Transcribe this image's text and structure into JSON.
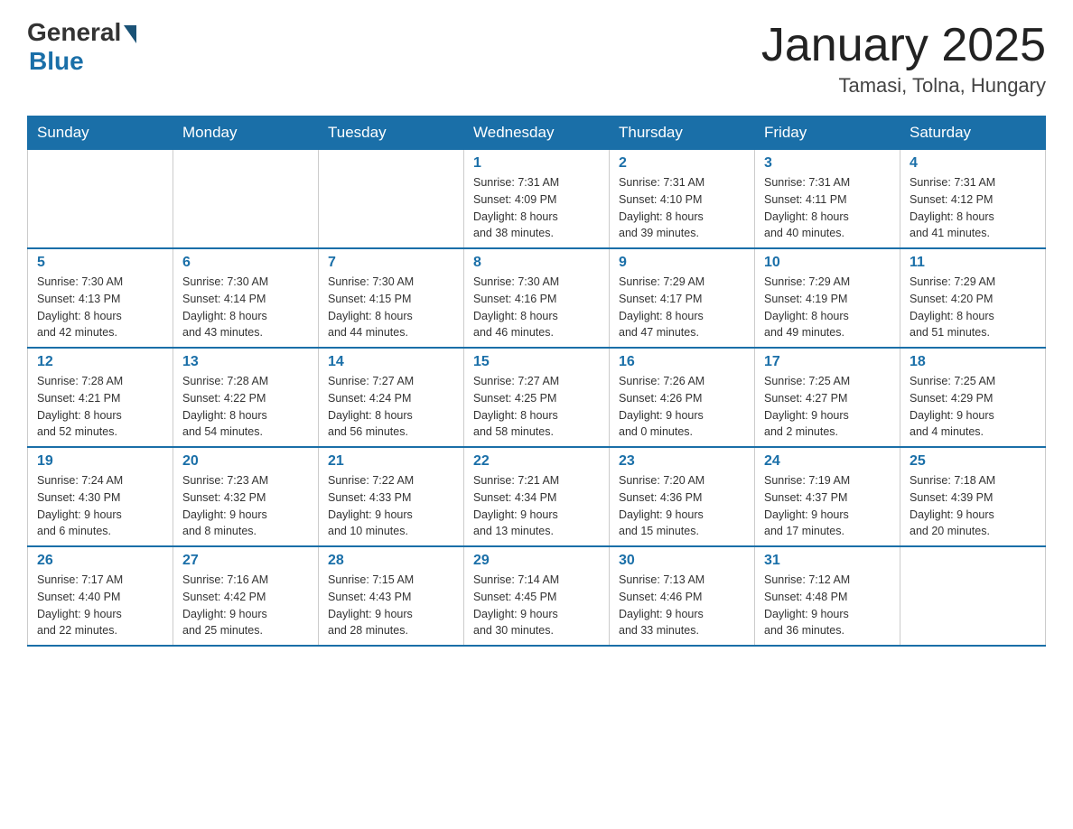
{
  "header": {
    "logo_general": "General",
    "logo_blue": "Blue",
    "month_title": "January 2025",
    "location": "Tamasi, Tolna, Hungary"
  },
  "days_of_week": [
    "Sunday",
    "Monday",
    "Tuesday",
    "Wednesday",
    "Thursday",
    "Friday",
    "Saturday"
  ],
  "weeks": [
    [
      {
        "day": "",
        "info": ""
      },
      {
        "day": "",
        "info": ""
      },
      {
        "day": "",
        "info": ""
      },
      {
        "day": "1",
        "info": "Sunrise: 7:31 AM\nSunset: 4:09 PM\nDaylight: 8 hours\nand 38 minutes."
      },
      {
        "day": "2",
        "info": "Sunrise: 7:31 AM\nSunset: 4:10 PM\nDaylight: 8 hours\nand 39 minutes."
      },
      {
        "day": "3",
        "info": "Sunrise: 7:31 AM\nSunset: 4:11 PM\nDaylight: 8 hours\nand 40 minutes."
      },
      {
        "day": "4",
        "info": "Sunrise: 7:31 AM\nSunset: 4:12 PM\nDaylight: 8 hours\nand 41 minutes."
      }
    ],
    [
      {
        "day": "5",
        "info": "Sunrise: 7:30 AM\nSunset: 4:13 PM\nDaylight: 8 hours\nand 42 minutes."
      },
      {
        "day": "6",
        "info": "Sunrise: 7:30 AM\nSunset: 4:14 PM\nDaylight: 8 hours\nand 43 minutes."
      },
      {
        "day": "7",
        "info": "Sunrise: 7:30 AM\nSunset: 4:15 PM\nDaylight: 8 hours\nand 44 minutes."
      },
      {
        "day": "8",
        "info": "Sunrise: 7:30 AM\nSunset: 4:16 PM\nDaylight: 8 hours\nand 46 minutes."
      },
      {
        "day": "9",
        "info": "Sunrise: 7:29 AM\nSunset: 4:17 PM\nDaylight: 8 hours\nand 47 minutes."
      },
      {
        "day": "10",
        "info": "Sunrise: 7:29 AM\nSunset: 4:19 PM\nDaylight: 8 hours\nand 49 minutes."
      },
      {
        "day": "11",
        "info": "Sunrise: 7:29 AM\nSunset: 4:20 PM\nDaylight: 8 hours\nand 51 minutes."
      }
    ],
    [
      {
        "day": "12",
        "info": "Sunrise: 7:28 AM\nSunset: 4:21 PM\nDaylight: 8 hours\nand 52 minutes."
      },
      {
        "day": "13",
        "info": "Sunrise: 7:28 AM\nSunset: 4:22 PM\nDaylight: 8 hours\nand 54 minutes."
      },
      {
        "day": "14",
        "info": "Sunrise: 7:27 AM\nSunset: 4:24 PM\nDaylight: 8 hours\nand 56 minutes."
      },
      {
        "day": "15",
        "info": "Sunrise: 7:27 AM\nSunset: 4:25 PM\nDaylight: 8 hours\nand 58 minutes."
      },
      {
        "day": "16",
        "info": "Sunrise: 7:26 AM\nSunset: 4:26 PM\nDaylight: 9 hours\nand 0 minutes."
      },
      {
        "day": "17",
        "info": "Sunrise: 7:25 AM\nSunset: 4:27 PM\nDaylight: 9 hours\nand 2 minutes."
      },
      {
        "day": "18",
        "info": "Sunrise: 7:25 AM\nSunset: 4:29 PM\nDaylight: 9 hours\nand 4 minutes."
      }
    ],
    [
      {
        "day": "19",
        "info": "Sunrise: 7:24 AM\nSunset: 4:30 PM\nDaylight: 9 hours\nand 6 minutes."
      },
      {
        "day": "20",
        "info": "Sunrise: 7:23 AM\nSunset: 4:32 PM\nDaylight: 9 hours\nand 8 minutes."
      },
      {
        "day": "21",
        "info": "Sunrise: 7:22 AM\nSunset: 4:33 PM\nDaylight: 9 hours\nand 10 minutes."
      },
      {
        "day": "22",
        "info": "Sunrise: 7:21 AM\nSunset: 4:34 PM\nDaylight: 9 hours\nand 13 minutes."
      },
      {
        "day": "23",
        "info": "Sunrise: 7:20 AM\nSunset: 4:36 PM\nDaylight: 9 hours\nand 15 minutes."
      },
      {
        "day": "24",
        "info": "Sunrise: 7:19 AM\nSunset: 4:37 PM\nDaylight: 9 hours\nand 17 minutes."
      },
      {
        "day": "25",
        "info": "Sunrise: 7:18 AM\nSunset: 4:39 PM\nDaylight: 9 hours\nand 20 minutes."
      }
    ],
    [
      {
        "day": "26",
        "info": "Sunrise: 7:17 AM\nSunset: 4:40 PM\nDaylight: 9 hours\nand 22 minutes."
      },
      {
        "day": "27",
        "info": "Sunrise: 7:16 AM\nSunset: 4:42 PM\nDaylight: 9 hours\nand 25 minutes."
      },
      {
        "day": "28",
        "info": "Sunrise: 7:15 AM\nSunset: 4:43 PM\nDaylight: 9 hours\nand 28 minutes."
      },
      {
        "day": "29",
        "info": "Sunrise: 7:14 AM\nSunset: 4:45 PM\nDaylight: 9 hours\nand 30 minutes."
      },
      {
        "day": "30",
        "info": "Sunrise: 7:13 AM\nSunset: 4:46 PM\nDaylight: 9 hours\nand 33 minutes."
      },
      {
        "day": "31",
        "info": "Sunrise: 7:12 AM\nSunset: 4:48 PM\nDaylight: 9 hours\nand 36 minutes."
      },
      {
        "day": "",
        "info": ""
      }
    ]
  ]
}
